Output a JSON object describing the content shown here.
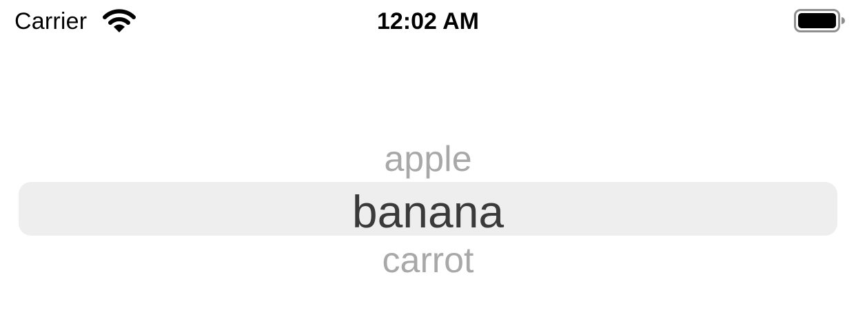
{
  "status_bar": {
    "carrier": "Carrier",
    "time": "12:02 AM",
    "wifi_icon": "wifi-icon",
    "battery_icon": "battery-icon"
  },
  "picker": {
    "items": [
      "apple",
      "banana",
      "carrot"
    ],
    "selected_index": 1,
    "selected_value": "banana",
    "colors": {
      "selected_text": "#3a3a3a",
      "unselected_text": "#a8a8a8",
      "selection_band": "#eeeeee"
    }
  }
}
